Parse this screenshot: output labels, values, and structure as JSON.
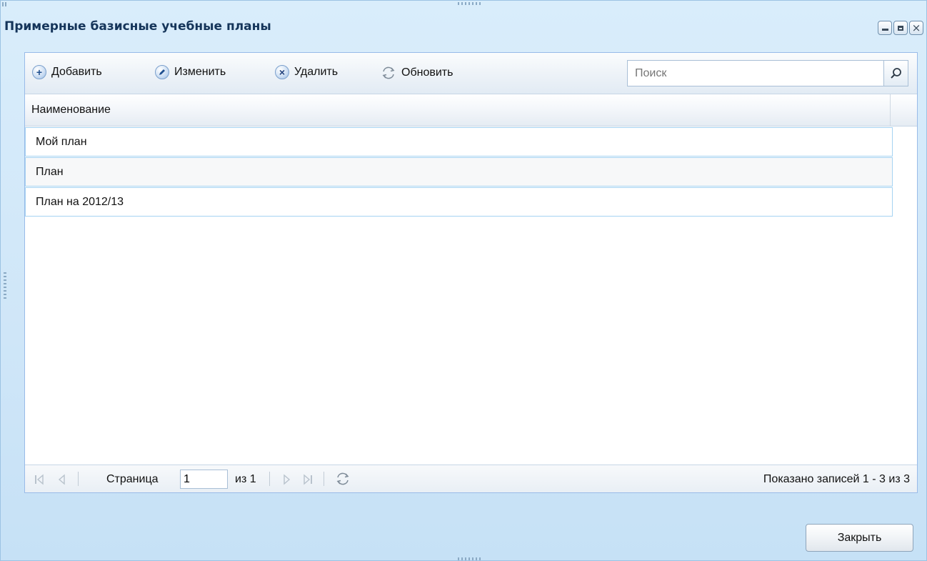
{
  "window": {
    "title": "Примерные базисные учебные планы"
  },
  "toolbar": {
    "add_label": "Добавить",
    "edit_label": "Изменить",
    "delete_label": "Удалить",
    "refresh_label": "Обновить",
    "search_placeholder": "Поиск"
  },
  "grid": {
    "column_name": "Наименование",
    "rows": [
      {
        "name": "Мой план"
      },
      {
        "name": "План"
      },
      {
        "name": "План на 2012/13"
      }
    ]
  },
  "pager": {
    "page_label": "Страница",
    "page_value": "1",
    "of_label": "из 1",
    "summary": "Показано записей 1 - 3 из 3"
  },
  "footer": {
    "close_label": "Закрыть"
  },
  "colors": {
    "title_text": "#15355a",
    "window_bg": "#cfe6f8",
    "row_border": "#a6d3f2"
  }
}
